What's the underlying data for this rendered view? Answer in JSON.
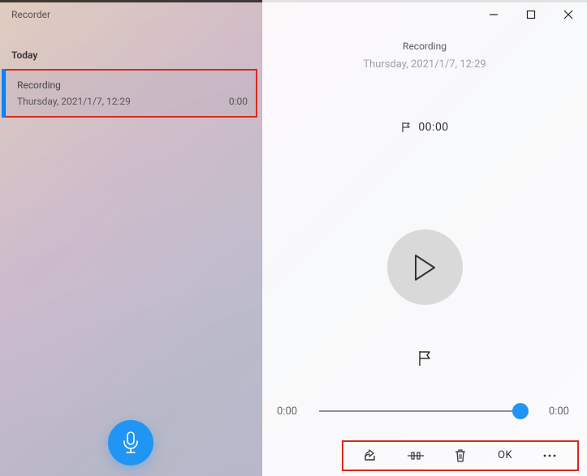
{
  "app": {
    "title": "Recorder"
  },
  "sidebar": {
    "section": "Today",
    "items": [
      {
        "title": "Recording",
        "date": "Thursday, 2021/1/7, 12:29",
        "duration": "0:00"
      }
    ]
  },
  "detail": {
    "title": "Recording",
    "date": "Thursday, 2021/1/7, 12:29",
    "marker_time": "00:00",
    "scrub_start": "0:00",
    "scrub_end": "0:00"
  },
  "toolbar": {
    "ok_label": "OK"
  }
}
